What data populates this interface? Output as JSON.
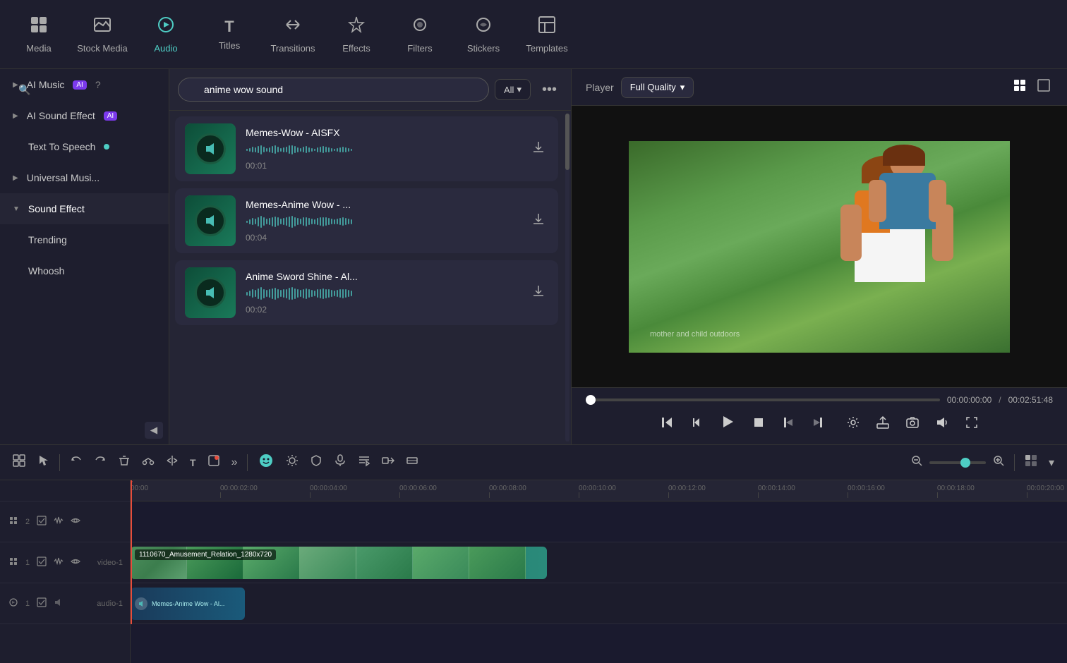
{
  "nav": {
    "items": [
      {
        "id": "media",
        "label": "Media",
        "icon": "🖼",
        "active": false
      },
      {
        "id": "stock-media",
        "label": "Stock Media",
        "icon": "📁",
        "active": false
      },
      {
        "id": "audio",
        "label": "Audio",
        "icon": "♪",
        "active": true
      },
      {
        "id": "titles",
        "label": "Titles",
        "icon": "T",
        "active": false
      },
      {
        "id": "transitions",
        "label": "Transitions",
        "icon": "↔",
        "active": false
      },
      {
        "id": "effects",
        "label": "Effects",
        "icon": "✦",
        "active": false
      },
      {
        "id": "filters",
        "label": "Filters",
        "icon": "◎",
        "active": false
      },
      {
        "id": "stickers",
        "label": "Stickers",
        "icon": "⬡",
        "active": false
      },
      {
        "id": "templates",
        "label": "Templates",
        "icon": "⊞",
        "active": false
      }
    ]
  },
  "sidebar": {
    "items": [
      {
        "id": "ai-music",
        "label": "AI Music",
        "arrow": "▶",
        "badge": "AI",
        "hasBadge": true
      },
      {
        "id": "ai-sound-effect",
        "label": "AI Sound Effect",
        "arrow": "▶",
        "badge": "AI",
        "hasBadge": true
      },
      {
        "id": "text-to-speech",
        "label": "Text To Speech",
        "arrow": "",
        "dot": true
      },
      {
        "id": "universal-music",
        "label": "Universal Musi...",
        "arrow": "▶",
        "hasBadge": false
      },
      {
        "id": "sound-effect",
        "label": "Sound Effect",
        "arrow": "▼",
        "hasBadge": false,
        "active": true
      },
      {
        "id": "trending",
        "label": "Trending",
        "indent": true
      },
      {
        "id": "whoosh",
        "label": "Whoosh",
        "indent": true
      }
    ]
  },
  "search": {
    "placeholder": "anime wow sound",
    "value": "anime wow sound",
    "filter_label": "All",
    "more_label": "•••"
  },
  "audio_results": [
    {
      "id": 1,
      "title": "Memes-Wow - AISFX",
      "duration": "00:01",
      "waveform_heights": [
        2,
        3,
        5,
        4,
        6,
        8,
        5,
        3,
        4,
        6,
        7,
        5,
        3,
        4,
        5,
        7,
        8,
        6,
        4,
        3,
        5,
        6,
        4,
        3,
        2,
        4,
        5,
        6,
        5,
        4,
        3,
        2,
        3,
        4,
        5,
        4,
        3,
        2
      ]
    },
    {
      "id": 2,
      "title": "Memes-Anime Wow - ...",
      "duration": "00:04",
      "waveform_heights": [
        2,
        4,
        6,
        5,
        8,
        10,
        7,
        5,
        6,
        8,
        9,
        7,
        5,
        6,
        7,
        9,
        10,
        8,
        6,
        5,
        7,
        8,
        6,
        5,
        4,
        6,
        7,
        8,
        7,
        6,
        5,
        4,
        5,
        6,
        7,
        6,
        5,
        4
      ]
    },
    {
      "id": 3,
      "title": "Anime Sword Shine - Al...",
      "duration": "00:02",
      "waveform_heights": [
        3,
        5,
        7,
        6,
        9,
        11,
        8,
        6,
        7,
        9,
        10,
        8,
        6,
        7,
        8,
        10,
        11,
        9,
        7,
        6,
        8,
        9,
        7,
        6,
        5,
        7,
        8,
        9,
        8,
        7,
        6,
        5,
        6,
        7,
        8,
        7,
        6,
        5
      ]
    }
  ],
  "player": {
    "label": "Player",
    "quality": "Full Quality",
    "current_time": "00:00:00:00",
    "total_time": "00:02:51:48",
    "progress_percent": 0
  },
  "timeline": {
    "zoom_level": 60,
    "tracks": [
      {
        "id": "video-1",
        "label": "Video 1",
        "type": "video",
        "clip_label": "1110670_Amusement_Relation_1280x720",
        "clip_width": 590
      },
      {
        "id": "audio-1",
        "label": "Audio 1",
        "type": "audio",
        "clip_label": "Memes-Anime Wow - Al...",
        "clip_width": 160
      }
    ],
    "ruler_marks": [
      "00:00",
      "00:00:02:00",
      "00:00:04:00",
      "00:00:06:00",
      "00:00:08:00",
      "00:00:10:00",
      "00:00:12:00",
      "00:00:14:00",
      "00:00:16:00",
      "00:00:18:00",
      "00:00:20:00"
    ]
  },
  "toolbar": {
    "buttons": [
      "⊞",
      "⌖",
      "|",
      "↩",
      "↪",
      "🗑",
      "✂",
      "⇄",
      "T",
      "□",
      "»"
    ]
  },
  "colors": {
    "accent": "#4ecdc4",
    "bg_dark": "#1a1a2e",
    "bg_mid": "#1e1e2e",
    "bg_panel": "#252535",
    "border": "#333333",
    "playhead": "#e74c3c",
    "video_clip": "#1a6a5a",
    "audio_clip": "#1a4a3a"
  }
}
